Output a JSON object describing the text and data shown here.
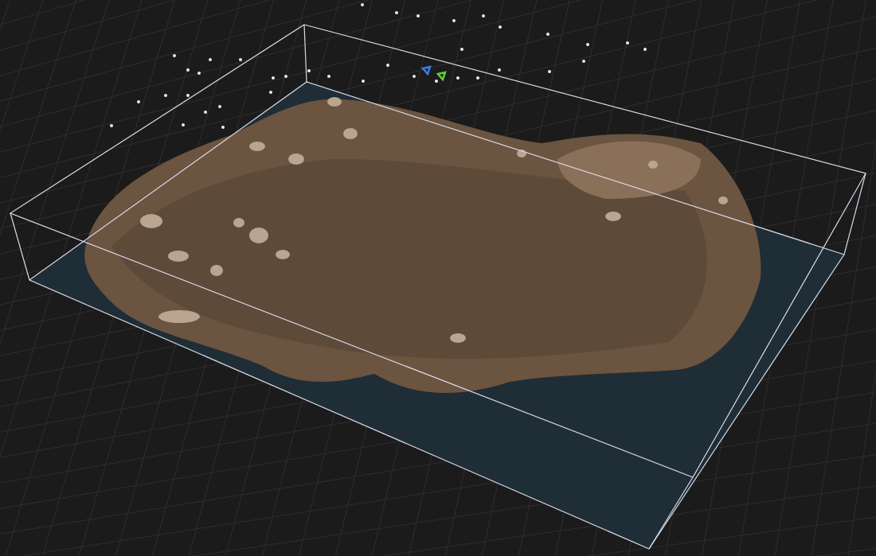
{
  "viewport": {
    "camera_markers": [
      {
        "color": "#3b7fe0"
      },
      {
        "color": "#5ad13a"
      }
    ]
  }
}
